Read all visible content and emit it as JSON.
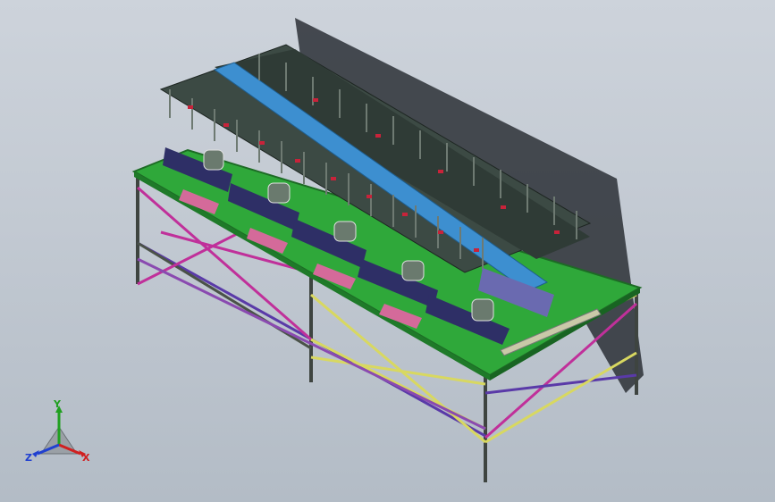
{
  "view": {
    "background_top": "#cdd3db",
    "background_bottom": "#b3bcc6",
    "model_colors": {
      "table_top": "#2fa83a",
      "frame": "#4a5248",
      "rail_blue": "#3d8fd0",
      "fixture_dark": "#3c4a44",
      "accent_red": "#c8233a",
      "accent_pink": "#d46a9a",
      "brace_magenta": "#c0309a",
      "brace_purple": "#5a3aa8",
      "brace_yellow": "#d8d860"
    }
  },
  "triad": {
    "x_label": "X",
    "y_label": "Y",
    "z_label": "Z",
    "x_color": "#d02020",
    "y_color": "#20a020",
    "z_color": "#2040d0"
  }
}
